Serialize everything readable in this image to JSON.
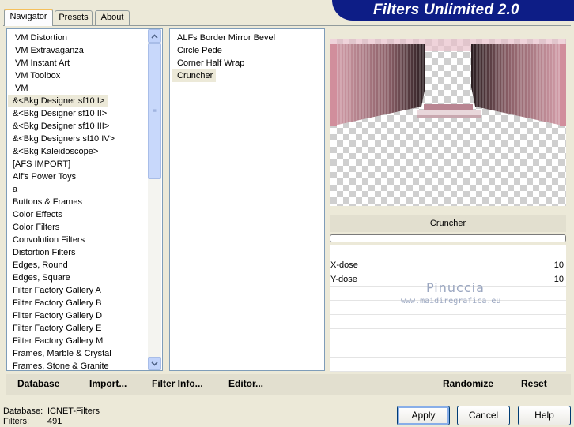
{
  "app": {
    "banner_title": "Filters Unlimited 2.0"
  },
  "tabs": [
    "Navigator",
    "Presets",
    "About"
  ],
  "categories": [
    "VM Distortion",
    "VM Extravaganza",
    "VM Instant Art",
    "VM Toolbox",
    "VM",
    "&<Bkg Designer sf10 I>",
    "&<Bkg Designer sf10 II>",
    "&<Bkg Designer sf10 III>",
    "&<Bkg Designers sf10 IV>",
    "&<Bkg Kaleidoscope>",
    "[AFS IMPORT]",
    "Alf's Power Toys",
    "a",
    "Buttons & Frames",
    "Color Effects",
    "Color Filters",
    "Convolution Filters",
    "Distortion Filters",
    "Edges, Round",
    "Edges, Square",
    "Filter Factory Gallery A",
    "Filter Factory Gallery B",
    "Filter Factory Gallery D",
    "Filter Factory Gallery E",
    "Filter Factory Gallery M",
    "Frames, Marble & Crystal",
    "Frames, Stone & Granite"
  ],
  "selected_category": "&<Bkg Designer sf10 I>",
  "filters": [
    "ALFs Border Mirror Bevel",
    "Circle Pede",
    "Corner Half Wrap",
    "Cruncher"
  ],
  "selected_filter": "Cruncher",
  "preview": {
    "filter_name": "Cruncher",
    "progress": 0,
    "watermark_name": "Pinuccia",
    "watermark_url": "www.maidiregrafica.eu"
  },
  "params": [
    {
      "label": "X-dose",
      "value": "10"
    },
    {
      "label": "Y-dose",
      "value": "10"
    }
  ],
  "toolbar": {
    "database": "Database",
    "import": "Import...",
    "filter_info": "Filter Info...",
    "editor": "Editor...",
    "randomize": "Randomize",
    "reset": "Reset"
  },
  "status": {
    "database_label": "Database:",
    "database_value": "ICNET-Filters",
    "filters_label": "Filters:",
    "filters_value": "491"
  },
  "buttons": {
    "apply": "Apply",
    "cancel": "Cancel",
    "help": "Help"
  },
  "colors": {
    "banner": "#0d1d86",
    "selection": "#ece9d8",
    "preview_pink": "#c98b98"
  }
}
